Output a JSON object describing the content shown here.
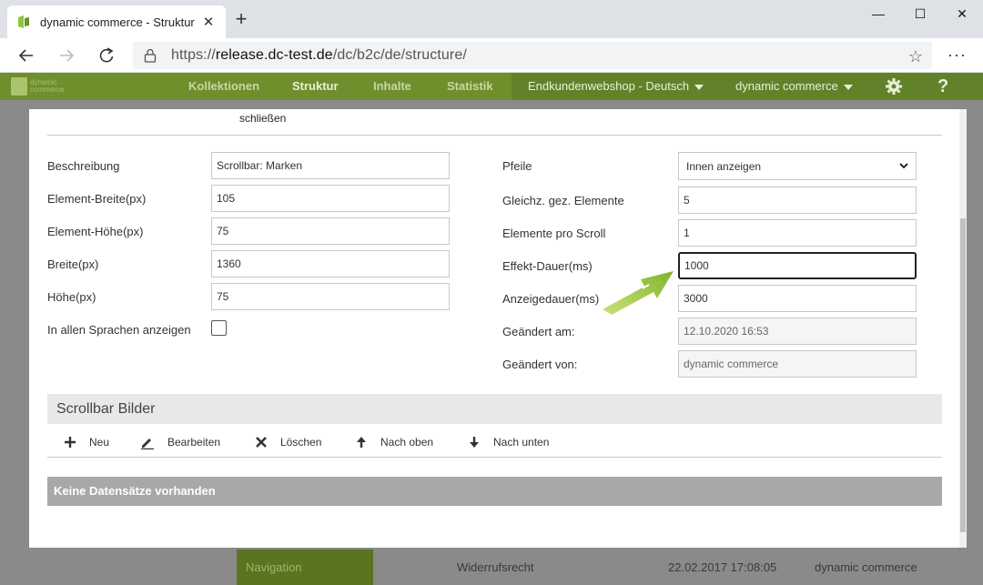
{
  "browser": {
    "tab_title": "dynamic commerce - Struktur",
    "new_tab": "+",
    "url_prefix": "https://",
    "url_host": "release.dc-test.de",
    "url_path": "/dc/b2c/de/structure/",
    "more": "···"
  },
  "appnav": {
    "logo_line1": "dynamic",
    "logo_line2": "commerce",
    "items": [
      "Kollektionen",
      "Struktur",
      "Inhalte",
      "Statistik"
    ],
    "shop_select": "Endkundenwebshop - Deutsch",
    "user_select": "dynamic commerce",
    "help": "?"
  },
  "background": {
    "nav_label": "Navigation",
    "row_title": "Widerrufsrecht",
    "row_date": "22.02.2017 17:08:05",
    "row_user": "dynamic commerce"
  },
  "dialog": {
    "close_label": "schließen",
    "left_fields": [
      {
        "label": "Beschreibung",
        "value": "Scrollbar: Marken"
      },
      {
        "label": "Element-Breite(px)",
        "value": "105"
      },
      {
        "label": "Element-Höhe(px)",
        "value": "75"
      },
      {
        "label": "Breite(px)",
        "value": "1360"
      },
      {
        "label": "Höhe(px)",
        "value": "75"
      }
    ],
    "all_languages_label": "In allen Sprachen anzeigen",
    "all_languages_checked": false,
    "right_fields": {
      "arrows_label": "Pfeile",
      "arrows_value": "Innen anzeigen",
      "visible_label": "Gleichz. gez. Elemente",
      "visible_value": "5",
      "per_scroll_label": "Elemente pro Scroll",
      "per_scroll_value": "1",
      "effect_label": "Effekt-Dauer(ms)",
      "effect_value": "1000",
      "display_label": "Anzeigedauer(ms)",
      "display_value": "3000",
      "changed_at_label": "Geändert am:",
      "changed_at_value": "12.10.2020 16:53",
      "changed_by_label": "Geändert von:",
      "changed_by_value": "dynamic commerce"
    },
    "section_title": "Scrollbar Bilder",
    "toolbar": {
      "new": "Neu",
      "edit": "Bearbeiten",
      "delete": "Löschen",
      "up": "Nach oben",
      "down": "Nach unten"
    },
    "empty_message": "Keine Datensätze vorhanden"
  },
  "colors": {
    "nav_green": "#6e8f2c",
    "accent_green": "#8dc63f",
    "overlay_gray": "#8a8a8a"
  }
}
